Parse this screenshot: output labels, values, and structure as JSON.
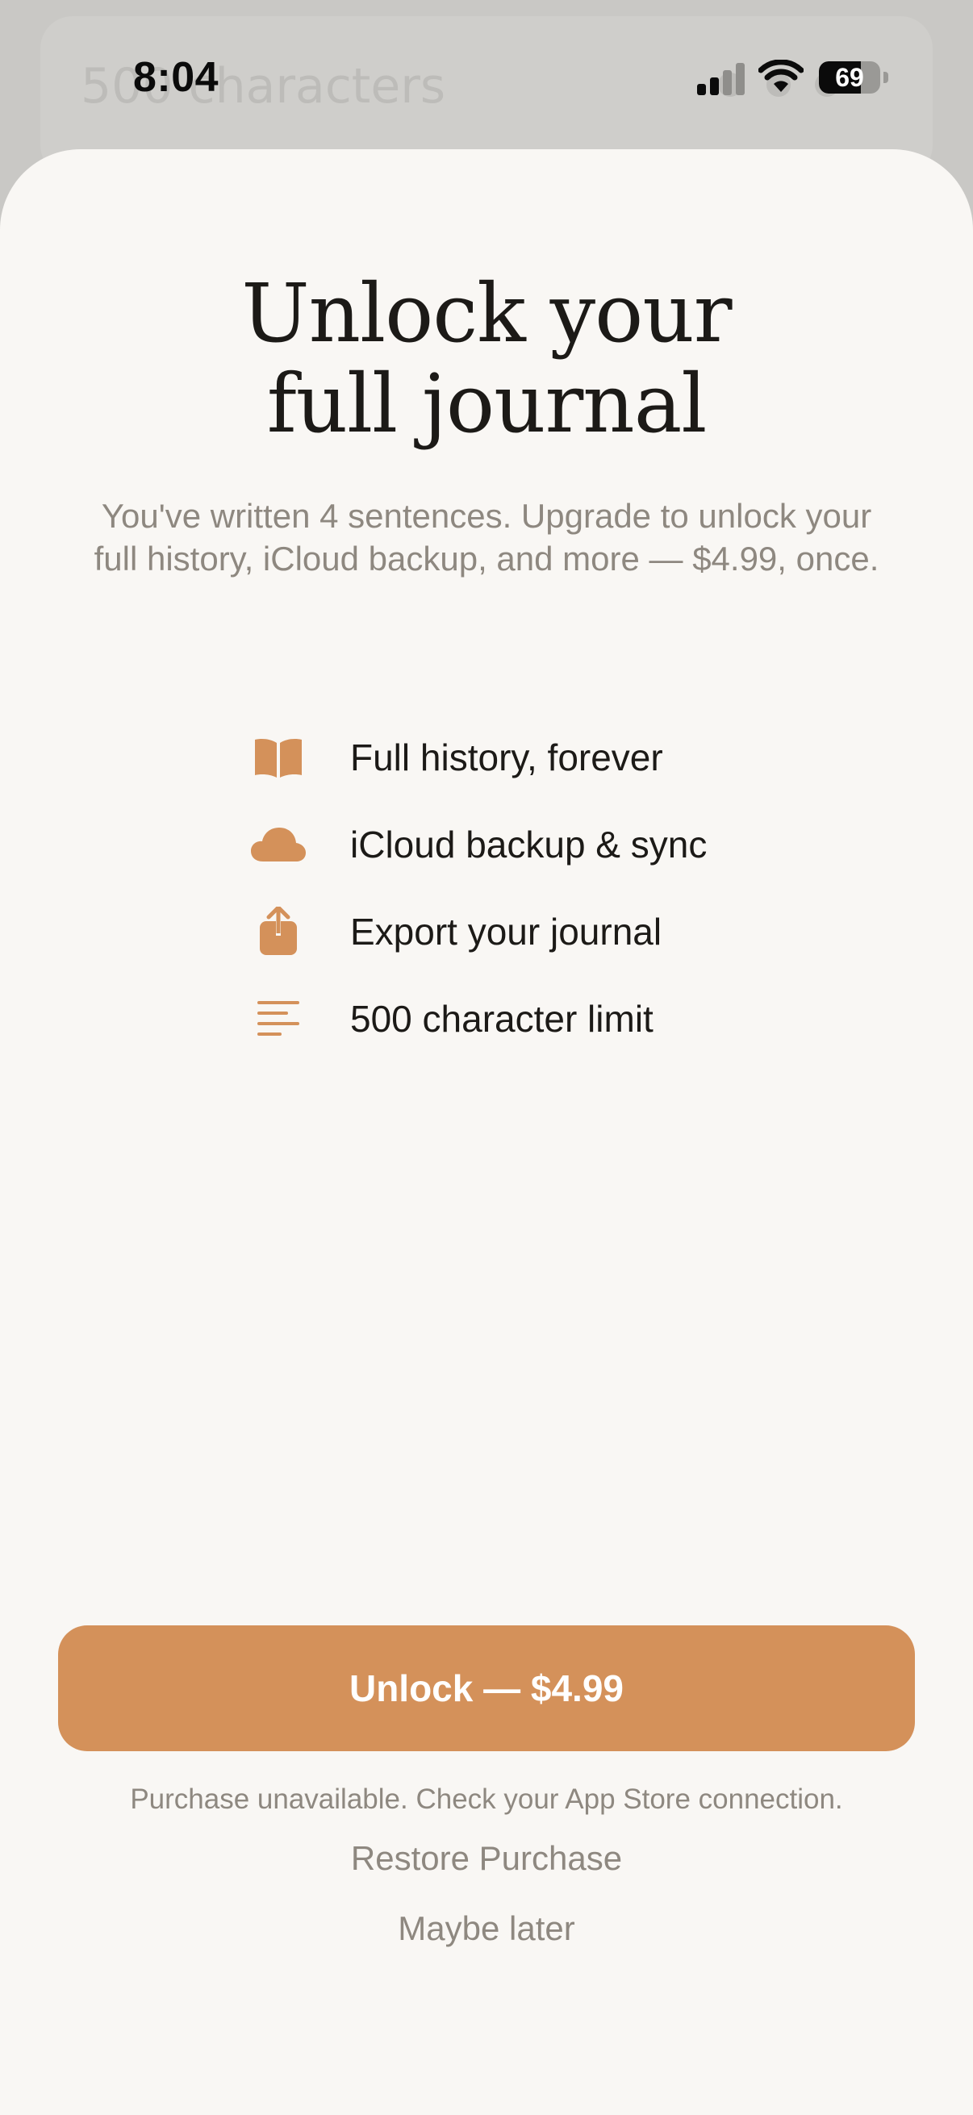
{
  "status_bar": {
    "time": "8:04",
    "battery_level": "69",
    "battery_fraction": 0.69
  },
  "background": {
    "ghost_text": "500 characters"
  },
  "paywall": {
    "title_line1": "Unlock your",
    "title_line2": "full journal",
    "subtitle": "You've written 4 sentences. Upgrade to unlock your full history, iCloud backup, and more — $4.99, once.",
    "features": [
      {
        "icon": "book-icon",
        "label": "Full history, forever"
      },
      {
        "icon": "cloud-icon",
        "label": "iCloud backup & sync"
      },
      {
        "icon": "share-icon",
        "label": "Export your journal"
      },
      {
        "icon": "text-lines-icon",
        "label": "500 character limit"
      }
    ],
    "unlock_button_label": "Unlock — $4.99",
    "purchase_note": "Purchase unavailable. Check your App Store connection.",
    "restore_label": "Restore Purchase",
    "later_label": "Maybe later"
  },
  "colors": {
    "accent": "#d4915a",
    "sheet_background": "#f9f7f4",
    "primary_text": "#1c1a17",
    "secondary_text": "#8e8880"
  }
}
